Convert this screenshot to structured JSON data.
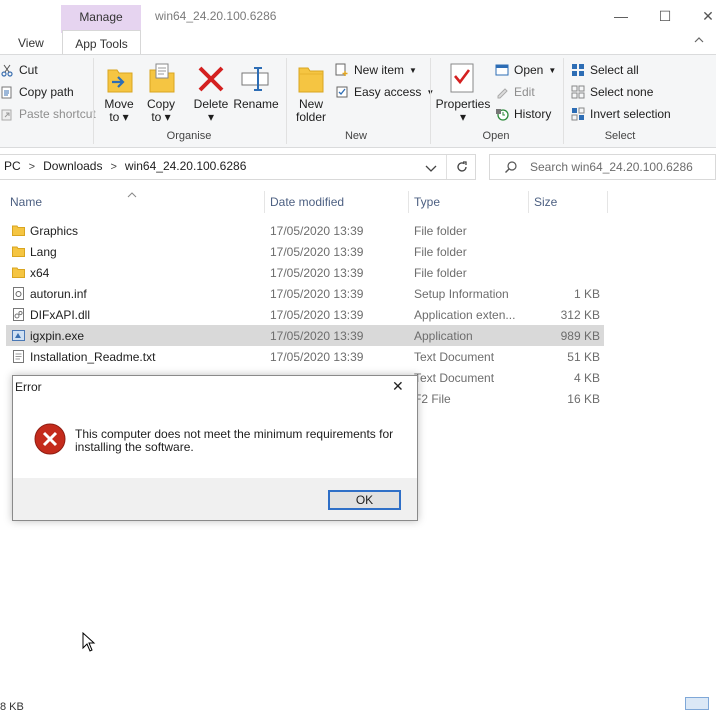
{
  "window": {
    "manage_tab": "Manage",
    "title": "win64_24.20.100.6286",
    "minimize_glyph": "—",
    "maximize_glyph": "☐",
    "close_glyph": "✕"
  },
  "tabs": {
    "view": "View",
    "app_tools": "App Tools"
  },
  "ribbon": {
    "clipboard": {
      "cut": "Cut",
      "copy_path": "Copy path",
      "paste_shortcut": "Paste shortcut"
    },
    "organise": {
      "label": "Organise",
      "move_to_line1": "Move",
      "move_to_line2": "to",
      "copy_to_line1": "Copy",
      "copy_to_line2": "to",
      "delete": "Delete",
      "rename": "Rename"
    },
    "new": {
      "label": "New",
      "new_folder_line1": "New",
      "new_folder_line2": "folder",
      "new_item": "New item",
      "easy_access": "Easy access"
    },
    "open": {
      "label": "Open",
      "properties": "Properties",
      "open": "Open",
      "edit": "Edit",
      "history": "History"
    },
    "select": {
      "label": "Select",
      "select_all": "Select all",
      "select_none": "Select none",
      "invert_selection": "Invert selection"
    }
  },
  "address": {
    "crumb1": "PC",
    "crumb2": "Downloads",
    "crumb3": "win64_24.20.100.6286",
    "search_placeholder": "Search win64_24.20.100.6286"
  },
  "columns": {
    "name": "Name",
    "date": "Date modified",
    "type": "Type",
    "size": "Size"
  },
  "files": [
    {
      "name": "Graphics",
      "date": "17/05/2020 13:39",
      "type": "File folder",
      "size": "",
      "icon": "folder-icon"
    },
    {
      "name": "Lang",
      "date": "17/05/2020 13:39",
      "type": "File folder",
      "size": "",
      "icon": "folder-icon"
    },
    {
      "name": "x64",
      "date": "17/05/2020 13:39",
      "type": "File folder",
      "size": "",
      "icon": "folder-icon"
    },
    {
      "name": "autorun.inf",
      "date": "17/05/2020 13:39",
      "type": "Setup Information",
      "size": "1 KB",
      "icon": "settings-file-icon"
    },
    {
      "name": "DIFxAPI.dll",
      "date": "17/05/2020 13:39",
      "type": "Application exten...",
      "size": "312 KB",
      "icon": "dll-file-icon"
    },
    {
      "name": "igxpin.exe",
      "date": "17/05/2020 13:39",
      "type": "Application",
      "size": "989 KB",
      "icon": "exe-file-icon"
    },
    {
      "name": "Installation_Readme.txt",
      "date": "17/05/2020 13:39",
      "type": "Text Document",
      "size": "51 KB",
      "icon": "text-file-icon"
    },
    {
      "name": "",
      "date": "",
      "type": "Text Document",
      "size": "4 KB",
      "icon": "text-file-icon"
    },
    {
      "name": "",
      "date": "",
      "type": "F2 File",
      "size": "16 KB",
      "icon": "file-icon"
    }
  ],
  "dialog": {
    "title": "Error",
    "close_glyph": "✕",
    "message_line1": "This computer does not meet the minimum requirements for",
    "message_line2": "installing the software.",
    "ok": "OK"
  },
  "status": {
    "text": "8 KB"
  },
  "colors": {
    "manage_accent": "#e6d4f0",
    "selection": "#d9d9d9",
    "error_red": "#c42b1c",
    "ok_border": "#2f6fc7"
  }
}
